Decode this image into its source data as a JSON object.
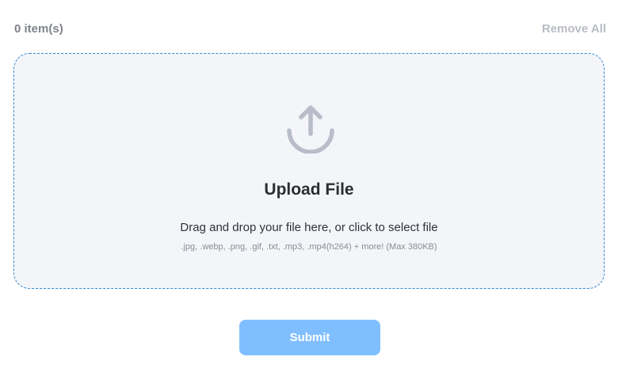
{
  "header": {
    "item_count": "0 item(s)",
    "remove_all_label": "Remove All"
  },
  "dropzone": {
    "icon": "upload-arrow-icon",
    "title": "Upload File",
    "hint": "Drag and drop your file here, or click to select file",
    "formats": ".jpg, .webp, .png, .gif, .txt, .mp3, .mp4(h264) + more! (Max 380KB)"
  },
  "footer": {
    "submit_label": "Submit"
  },
  "colors": {
    "dropzone_border": "#2f86d6",
    "dropzone_bg": "#f4f5f9",
    "submit_bg": "#80bfff",
    "icon": "#b9bcc9"
  }
}
